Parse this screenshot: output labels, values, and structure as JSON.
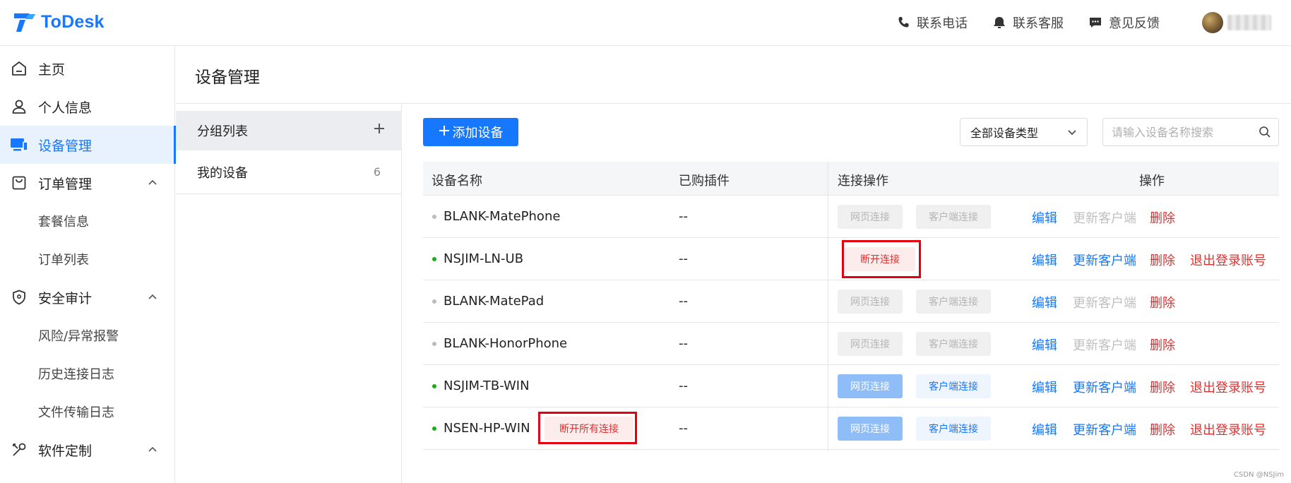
{
  "header": {
    "brand": "ToDesk",
    "links": [
      {
        "label": "联系电话",
        "icon": "phone-icon"
      },
      {
        "label": "联系客服",
        "icon": "headset-icon"
      },
      {
        "label": "意见反馈",
        "icon": "chat-icon"
      }
    ]
  },
  "sidebar": {
    "items": [
      {
        "label": "主页",
        "icon": "home-icon"
      },
      {
        "label": "个人信息",
        "icon": "user-icon"
      },
      {
        "label": "设备管理",
        "icon": "devices-icon",
        "active": true
      },
      {
        "label": "订单管理",
        "icon": "bag-icon",
        "expanded": true
      },
      {
        "label": "套餐信息"
      },
      {
        "label": "订单列表"
      },
      {
        "label": "安全审计",
        "icon": "shield-icon",
        "expanded": true
      },
      {
        "label": "风险/异常报警"
      },
      {
        "label": "历史连接日志"
      },
      {
        "label": "文件传输日志"
      },
      {
        "label": "软件定制",
        "icon": "tools-icon",
        "expanded": true
      }
    ]
  },
  "page": {
    "title": "设备管理"
  },
  "groups": {
    "header_label": "分组列表",
    "items": [
      {
        "label": "我的设备",
        "count": "6"
      }
    ]
  },
  "toolbar": {
    "add_label": "添加设备",
    "type_select": "全部设备类型",
    "search_placeholder": "请输入设备名称搜索"
  },
  "table": {
    "columns": [
      "设备名称",
      "已购插件",
      "连接操作",
      "操作"
    ],
    "rows": [
      {
        "name": "BLANK-MatePhone",
        "online": false,
        "plugin": "--",
        "web": "网页连接",
        "client": "客户端连接",
        "edit": "编辑",
        "update": "更新客户端",
        "delete": "删除"
      },
      {
        "name": "NSJIM-LN-UB",
        "online": true,
        "plugin": "--",
        "disconnect": "断开连接",
        "edit": "编辑",
        "update": "更新客户端",
        "delete": "删除",
        "logout": "退出登录账号"
      },
      {
        "name": "BLANK-MatePad",
        "online": false,
        "plugin": "--",
        "web": "网页连接",
        "client": "客户端连接",
        "edit": "编辑",
        "update": "更新客户端",
        "delete": "删除"
      },
      {
        "name": "BLANK-HonorPhone",
        "online": false,
        "plugin": "--",
        "web": "网页连接",
        "client": "客户端连接",
        "edit": "编辑",
        "update": "更新客户端",
        "delete": "删除"
      },
      {
        "name": "NSJIM-TB-WIN",
        "online": true,
        "plugin": "--",
        "web": "网页连接",
        "client": "客户端连接",
        "edit": "编辑",
        "update": "更新客户端",
        "delete": "删除",
        "logout": "退出登录账号"
      },
      {
        "name": "NSEN-HP-WIN",
        "online": true,
        "plugin": "--",
        "disconnect_all": "断开所有连接",
        "web": "网页连接",
        "client": "客户端连接",
        "edit": "编辑",
        "update": "更新客户端",
        "delete": "删除",
        "logout": "退出登录账号"
      }
    ]
  },
  "watermark": "CSDN @NSJim",
  "colors": {
    "accent": "#1677ff",
    "danger": "#e03030",
    "online": "#1aad19",
    "offline": "#bbbbbb",
    "annotation": "#e3000f"
  }
}
